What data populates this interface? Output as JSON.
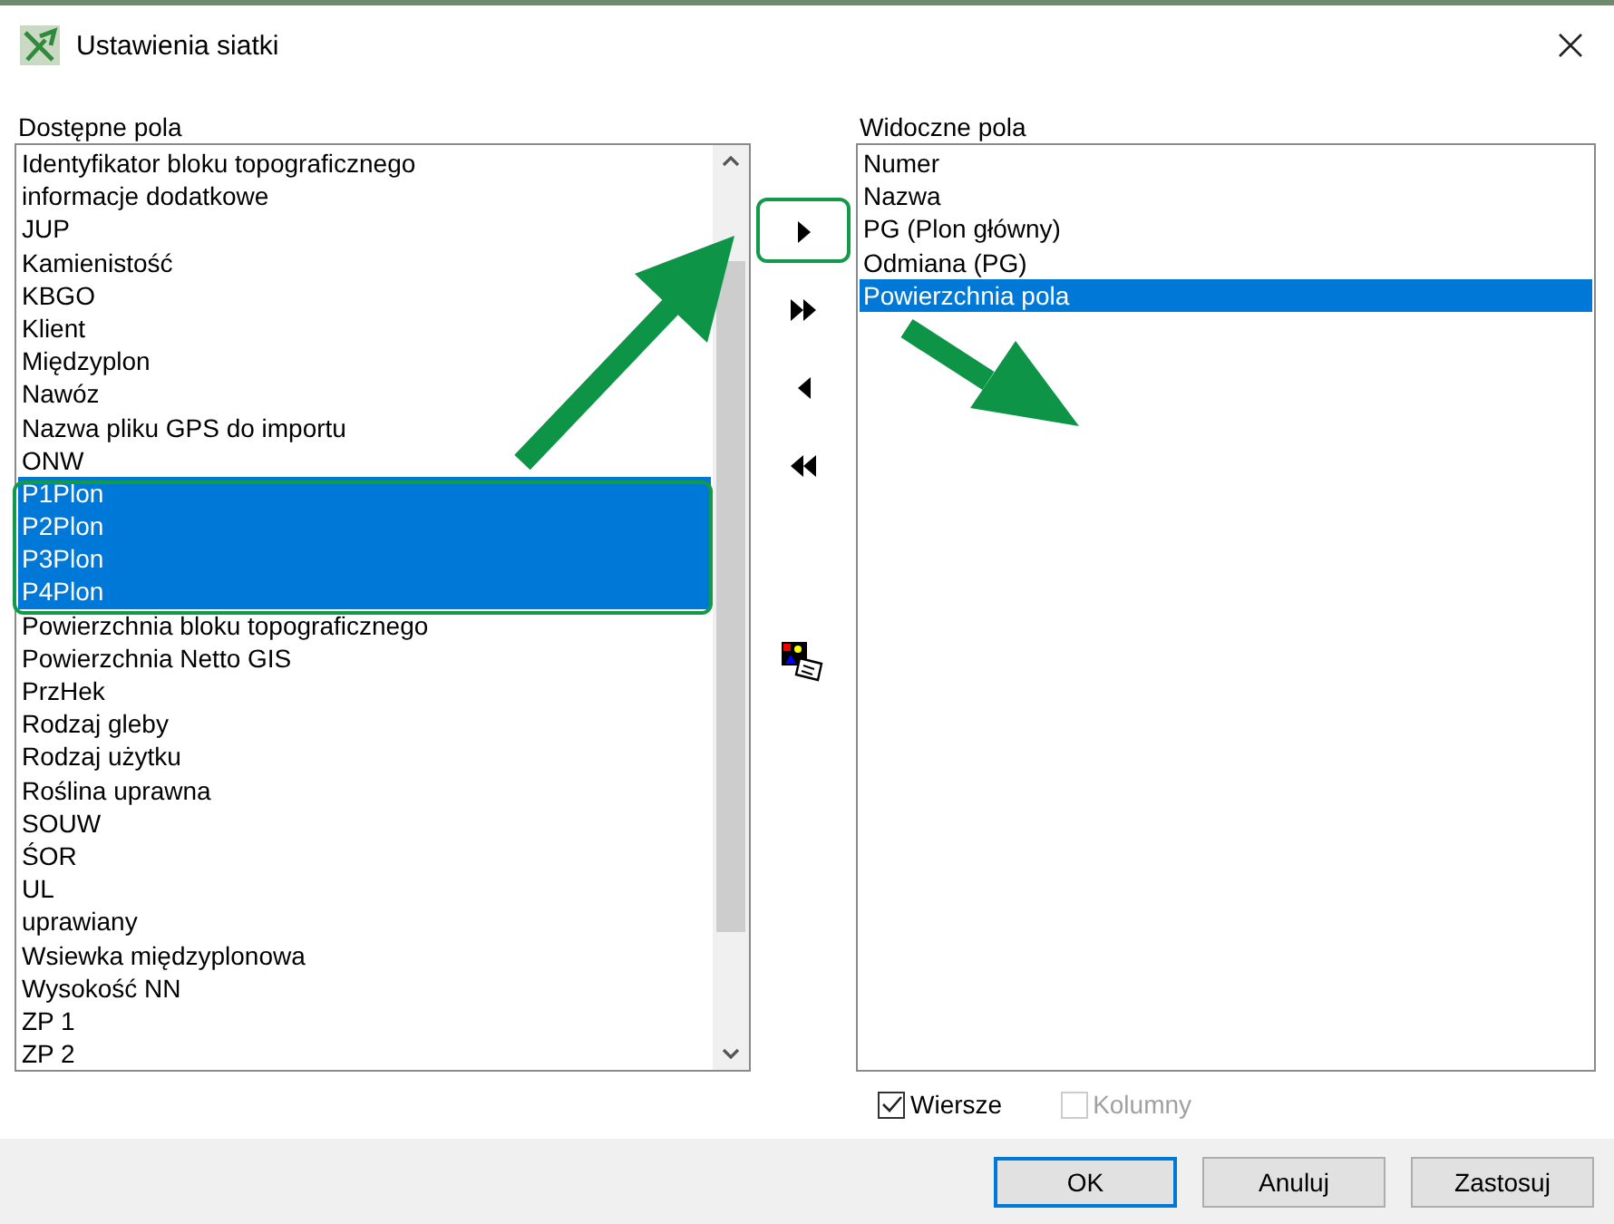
{
  "window": {
    "title": "Ustawienia siatki"
  },
  "available": {
    "label": "Dostępne pola",
    "items": [
      {
        "text": "Identyfikator bloku topograficznego",
        "selected": false
      },
      {
        "text": "informacje dodatkowe",
        "selected": false
      },
      {
        "text": "JUP",
        "selected": false
      },
      {
        "text": "Kamienistość",
        "selected": false
      },
      {
        "text": "KBGO",
        "selected": false
      },
      {
        "text": "Klient",
        "selected": false
      },
      {
        "text": "Międzyplon",
        "selected": false
      },
      {
        "text": "Nawóz",
        "selected": false
      },
      {
        "text": "Nazwa pliku GPS do importu",
        "selected": false
      },
      {
        "text": "ONW",
        "selected": false
      },
      {
        "text": "P1Plon",
        "selected": true
      },
      {
        "text": "P2Plon",
        "selected": true
      },
      {
        "text": "P3Plon",
        "selected": true
      },
      {
        "text": "P4Plon",
        "selected": true
      },
      {
        "text": "Powierzchnia bloku topograficznego",
        "selected": false
      },
      {
        "text": "Powierzchnia Netto GIS",
        "selected": false
      },
      {
        "text": "PrzHek",
        "selected": false
      },
      {
        "text": "Rodzaj gleby",
        "selected": false
      },
      {
        "text": "Rodzaj użytku",
        "selected": false
      },
      {
        "text": "Roślina uprawna",
        "selected": false
      },
      {
        "text": "SOUW",
        "selected": false
      },
      {
        "text": "ŚOR",
        "selected": false
      },
      {
        "text": "UL",
        "selected": false
      },
      {
        "text": "uprawiany",
        "selected": false
      },
      {
        "text": "Wsiewka międzyplonowa",
        "selected": false
      },
      {
        "text": "Wysokość NN",
        "selected": false
      },
      {
        "text": "ZP 1",
        "selected": false
      },
      {
        "text": "ZP 2",
        "selected": false
      }
    ]
  },
  "visible": {
    "label": "Widoczne pola",
    "items": [
      {
        "text": "Numer",
        "selected": false
      },
      {
        "text": "Nazwa",
        "selected": false
      },
      {
        "text": "PG (Plon główny)",
        "selected": false
      },
      {
        "text": "Odmiana (PG)",
        "selected": false
      },
      {
        "text": "Powierzchnia pola",
        "selected": true
      }
    ]
  },
  "checkboxes": [
    {
      "label": "Wiersze",
      "checked": true,
      "disabled": false
    },
    {
      "label": "Kolumny",
      "checked": false,
      "disabled": true
    }
  ],
  "buttons": [
    {
      "label": "OK",
      "default": true
    },
    {
      "label": "Anuluj",
      "default": false
    },
    {
      "label": "Zastosuj",
      "default": false
    }
  ]
}
